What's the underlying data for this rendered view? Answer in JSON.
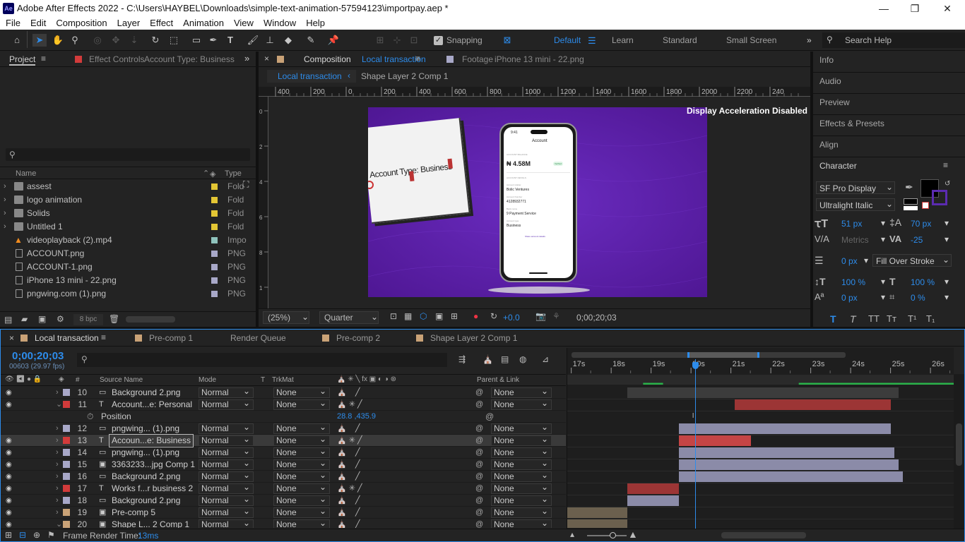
{
  "window": {
    "title": "Adobe After Effects 2022 - C:\\Users\\HAYBEL\\Downloads\\simple-text-animation-57594123\\importpay.aep *",
    "app_icon_label": "Ae"
  },
  "menu": [
    "File",
    "Edit",
    "Composition",
    "Layer",
    "Effect",
    "Animation",
    "View",
    "Window",
    "Help"
  ],
  "toolbar": {
    "snapping_label": "Snapping",
    "workspaces": [
      "Default",
      "Learn",
      "Standard",
      "Small Screen"
    ],
    "active_workspace": "Default",
    "search_placeholder": "Search Help"
  },
  "project_panel": {
    "tab_project": "Project",
    "tab_effect_controls": "Effect Controls",
    "effect_controls_target": "Account Type: Business",
    "col_name": "Name",
    "col_type": "Type",
    "bpc": "8 bpc",
    "items": [
      {
        "name": "assest",
        "type": "Fold",
        "kind": "folder",
        "color": "#e3c634"
      },
      {
        "name": "logo animation",
        "type": "Fold",
        "kind": "folder",
        "color": "#e3c634"
      },
      {
        "name": "Solids",
        "type": "Fold",
        "kind": "folder",
        "color": "#e3c634"
      },
      {
        "name": "Untitled 1",
        "type": "Fold",
        "kind": "folder",
        "color": "#e3c634"
      },
      {
        "name": "videoplayback (2).mp4",
        "type": "Impo",
        "kind": "video",
        "color": "#8fc3bc"
      },
      {
        "name": "ACCOUNT.png",
        "type": "PNG",
        "kind": "file",
        "color": "#a8a8c8"
      },
      {
        "name": "ACCOUNT-1.png",
        "type": "PNG",
        "kind": "file",
        "color": "#a8a8c8"
      },
      {
        "name": "iPhone 13 mini - 22.png",
        "type": "PNG",
        "kind": "file",
        "color": "#a8a8c8"
      },
      {
        "name": "pngwing.com (1).png",
        "type": "PNG",
        "kind": "file",
        "color": "#a8a8c8"
      }
    ]
  },
  "composition_panel": {
    "tab_prefix": "Composition",
    "tab_name": "Local transaction",
    "footage_prefix": "Footage",
    "footage_name": "iPhone 13 mini - 22.png",
    "breadcrumb": [
      "Local transaction",
      "Shape Layer 2 Comp 1"
    ],
    "ruler_top": [
      "400",
      "200",
      "0",
      "200",
      "400",
      "600",
      "800",
      "1000",
      "1200",
      "1400",
      "1600",
      "1800",
      "2000",
      "2200",
      "240"
    ],
    "notice": "Display Acceleration Disabled",
    "zoom": "(25%)",
    "resolution": "Quarter",
    "exposure": "+0.0",
    "timecode": "0;00;20;03",
    "artwork": {
      "card_text": "Account Type: Business",
      "phone_time": "9:41",
      "phone_header": "Account",
      "phone_balance_label": "ACCOUNT BALANCE",
      "phone_balance": "₦ 4.58M",
      "phone_badge": "Verified",
      "phone_section": "ACCOUNT DETAILS",
      "phone_fields": [
        {
          "label": "Account Holder",
          "value": "Bolic Ventures"
        },
        {
          "label": "Account Number",
          "value": "4128932771"
        },
        {
          "label": "Bank name",
          "value": "9 Payment Service"
        },
        {
          "label": "Account type",
          "value": "Business"
        }
      ],
      "phone_link": "Share account details"
    }
  },
  "right_panels": [
    "Info",
    "Audio",
    "Preview",
    "Effects & Presets",
    "Align"
  ],
  "character_panel": {
    "title": "Character",
    "font": "SF Pro Display",
    "style": "Ultralight Italic",
    "size": "51 px",
    "leading": "70 px",
    "kerning": "Metrics",
    "tracking": "-25",
    "stroke_width": "0 px",
    "stroke_type": "Fill Over Stroke",
    "vscale": "100 %",
    "hscale": "100 %",
    "baseline": "0 px",
    "tsume": "0 %",
    "fill_color": "#000000",
    "stroke_color": "#5b2bb0"
  },
  "timeline": {
    "tabs": [
      {
        "label": "Local transaction",
        "color": "#c9a277",
        "active": true
      },
      {
        "label": "Pre-comp 1",
        "color": "#c9a277",
        "active": false
      },
      {
        "label": "Render Queue",
        "color": "",
        "active": false
      },
      {
        "label": "Pre-comp 2",
        "color": "#c9a277",
        "active": false
      },
      {
        "label": "Shape Layer 2 Comp 1",
        "color": "#c9a277",
        "active": false
      }
    ],
    "timecode": "0;00;20;03",
    "frame_info": "00603 (29.97 fps)",
    "col_hash": "#",
    "col_source": "Source Name",
    "col_mode": "Mode",
    "col_t": "T",
    "col_trkmat": "TrkMat",
    "col_parent": "Parent & Link",
    "ruler": [
      "17s",
      "18s",
      "19s",
      "20s",
      "21s",
      "22s",
      "23s",
      "24s",
      "25s",
      "26s"
    ],
    "ruler_start_s": 16.9,
    "ruler_end_s": 26.6,
    "playhead_s": 20.1,
    "work_area_s": [
      20.0,
      21.8
    ],
    "position_label": "Position",
    "position_value": "28.8 ,435.9",
    "layers": [
      {
        "num": "10",
        "name": "Background 2.png",
        "type": "img",
        "mode": "Normal",
        "trk": "None",
        "parent": "None",
        "color": "#a8a8c8",
        "eye": true,
        "twirl": "›",
        "bar": [
          18.4,
          25.2
        ],
        "bar_color": "#3c3c3c",
        "selected": false
      },
      {
        "num": "11",
        "name": "Account...e: Personal",
        "type": "T",
        "mode": "Normal",
        "trk": "None",
        "parent": "None",
        "color": "#d23b3b",
        "eye": true,
        "twirl": "⌄",
        "bar": [
          21.1,
          25.0
        ],
        "bar_color": "#9c3535",
        "selected": false
      },
      {
        "num": "12",
        "name": "pngwing... (1).png",
        "type": "img",
        "mode": "Normal",
        "trk": "None",
        "parent": "None",
        "color": "#a8a8c8",
        "eye": false,
        "twirl": "›",
        "bar": [
          19.7,
          25.0
        ],
        "bar_color": "#8b8ba8",
        "selected": false
      },
      {
        "num": "13",
        "name": "Accoun...e: Business",
        "type": "T",
        "mode": "Normal",
        "trk": "None",
        "parent": "None",
        "color": "#d23b3b",
        "eye": true,
        "twirl": "›",
        "bar": [
          19.7,
          21.5
        ],
        "bar_color": "#c54545",
        "selected": true
      },
      {
        "num": "14",
        "name": "pngwing... (1).png",
        "type": "img",
        "mode": "Normal",
        "trk": "None",
        "parent": "None",
        "color": "#a8a8c8",
        "eye": true,
        "twirl": "›",
        "bar": [
          19.7,
          25.1
        ],
        "bar_color": "#8b8ba8",
        "selected": false
      },
      {
        "num": "15",
        "name": "3363233...jpg Comp 1",
        "type": "comp",
        "mode": "Normal",
        "trk": "None",
        "parent": "None",
        "color": "#a8a8c8",
        "eye": true,
        "twirl": "›",
        "bar": [
          19.7,
          25.2
        ],
        "bar_color": "#8b8ba8",
        "selected": false
      },
      {
        "num": "16",
        "name": "Background 2.png",
        "type": "img",
        "mode": "Normal",
        "trk": "None",
        "parent": "None",
        "color": "#a8a8c8",
        "eye": true,
        "twirl": "›",
        "bar": [
          19.7,
          25.3
        ],
        "bar_color": "#8b8ba8",
        "selected": false
      },
      {
        "num": "17",
        "name": "Works f...r business 2",
        "type": "T",
        "mode": "Normal",
        "trk": "None",
        "parent": "None",
        "color": "#d23b3b",
        "eye": true,
        "twirl": "›",
        "bar": [
          18.4,
          19.7
        ],
        "bar_color": "#9c3535",
        "selected": false
      },
      {
        "num": "18",
        "name": "Background 2.png",
        "type": "img",
        "mode": "Normal",
        "trk": "None",
        "parent": "None",
        "color": "#a8a8c8",
        "eye": true,
        "twirl": "›",
        "bar": [
          18.4,
          19.7
        ],
        "bar_color": "#8b8ba8",
        "selected": false
      },
      {
        "num": "19",
        "name": "Pre-comp 5",
        "type": "comp",
        "mode": "Normal",
        "trk": "None",
        "parent": "None",
        "color": "#c9a277",
        "eye": true,
        "twirl": "›",
        "bar": [
          16.9,
          18.4
        ],
        "bar_color": "#6b604e",
        "selected": false
      },
      {
        "num": "20",
        "name": "Shape L... 2 Comp 1",
        "type": "comp",
        "mode": "Normal",
        "trk": "None",
        "parent": "None",
        "color": "#c9a277",
        "eye": true,
        "twirl": "⌄",
        "bar": [
          16.9,
          18.4
        ],
        "bar_color": "#6b604e",
        "selected": false
      }
    ],
    "frame_render_label": "Frame Render Time:",
    "frame_render_value": "13ms"
  }
}
